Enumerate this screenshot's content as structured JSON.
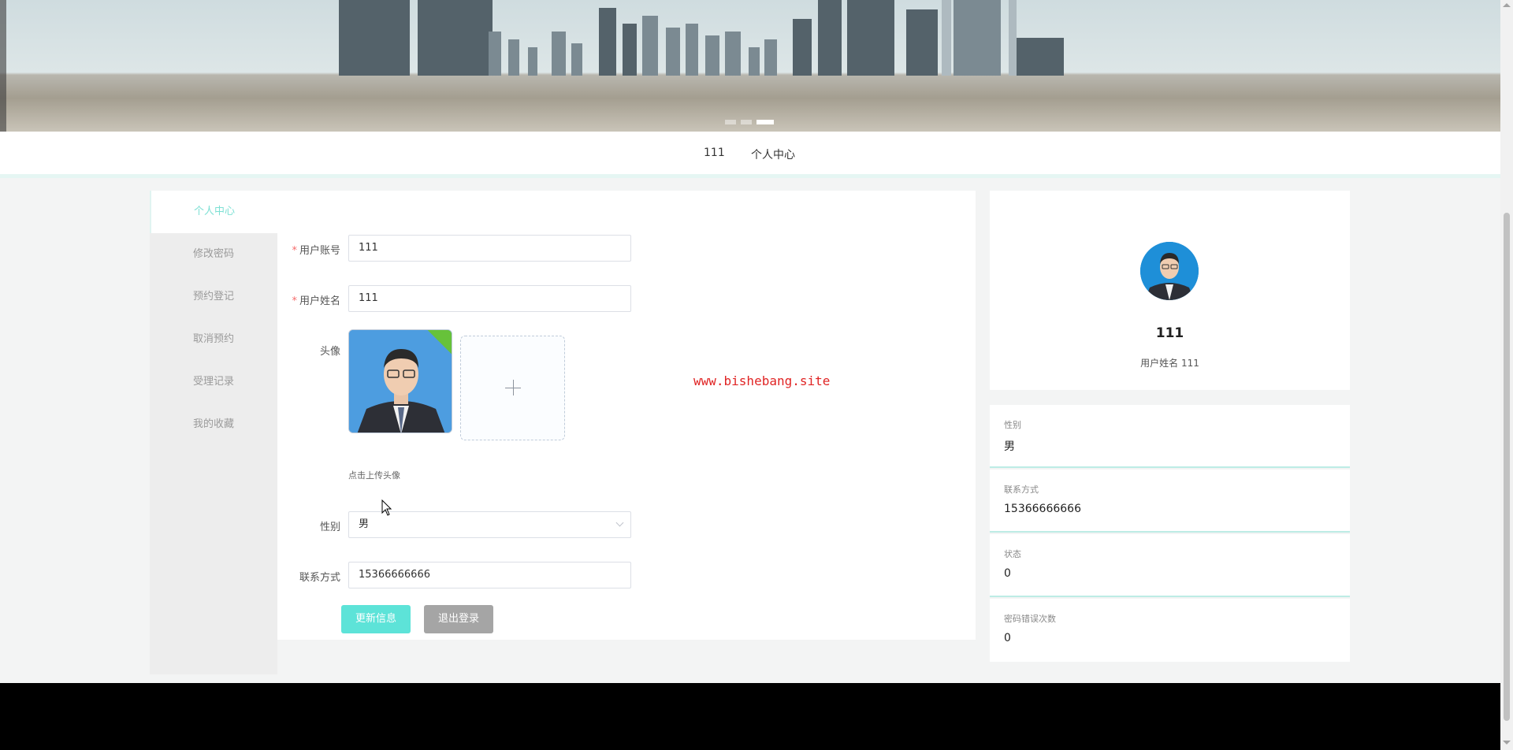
{
  "nav": {
    "items": [
      "111",
      "个人中心"
    ]
  },
  "sidebar": {
    "items": [
      {
        "label": "个人中心",
        "active": true
      },
      {
        "label": "修改密码",
        "active": false
      },
      {
        "label": "预约登记",
        "active": false
      },
      {
        "label": "取消预约",
        "active": false
      },
      {
        "label": "受理记录",
        "active": false
      },
      {
        "label": "我的收藏",
        "active": false
      }
    ]
  },
  "form": {
    "account": {
      "label": "用户账号",
      "value": "111",
      "required": true
    },
    "name": {
      "label": "用户姓名",
      "value": "111",
      "required": true
    },
    "avatar": {
      "label": "头像",
      "tip": "点击上传头像",
      "add_icon": "plus-icon"
    },
    "gender": {
      "label": "性别",
      "value": "男"
    },
    "contact": {
      "label": "联系方式",
      "value": "15366666666"
    },
    "update_button": "更新信息",
    "logout_button": "退出登录"
  },
  "watermark": "www.bishebang.site",
  "profile": {
    "name": "111",
    "subtitle_label": "用户姓名",
    "subtitle_value": "111"
  },
  "info": [
    {
      "label": "性别",
      "value": "男"
    },
    {
      "label": "联系方式",
      "value": "15366666666"
    },
    {
      "label": "状态",
      "value": "0"
    },
    {
      "label": "密码错误次数",
      "value": "0"
    }
  ],
  "colors": {
    "accent": "#5de3d8",
    "active_text": "#7de0d4",
    "required": "#f56c6c",
    "watermark": "#e02424"
  }
}
